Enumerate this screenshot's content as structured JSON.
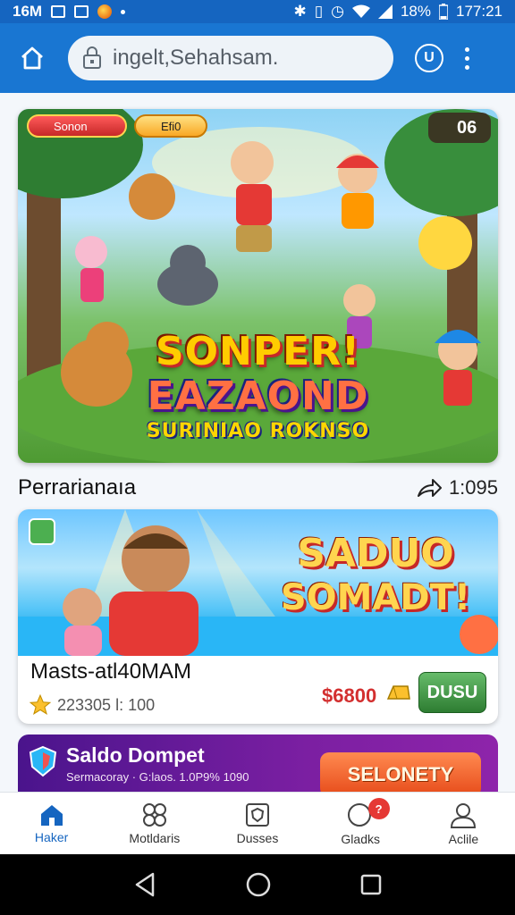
{
  "status_bar": {
    "left_text": "16M",
    "battery": "18%",
    "time": "177:21"
  },
  "browser": {
    "url": "ingelt,Sehahsam.",
    "tab_count": "U"
  },
  "hero": {
    "badge_left": "Sonon",
    "badge_mid": "Efi0",
    "badge_count": "06",
    "title_line1": "SONPER!",
    "title_line2": "EAZAOND",
    "title_line3": "SURINIAO ROKNSO"
  },
  "section": {
    "title": "Perrarianaıa",
    "share_count": "1:095"
  },
  "promo": {
    "title_line1": "SADUO",
    "title_line2": "SOMADT!",
    "name": "Masts-atl40MAM",
    "meta": "223305 l: 100",
    "price": "$6800",
    "buy_label": "DUSU"
  },
  "wallet": {
    "title": "Saldo Dompet",
    "subtitle": "Sermacoray · G:laos. 1.0P9% 1090",
    "button_label": "SELONETY"
  },
  "bottom_nav": [
    {
      "label": "Haker",
      "icon": "home-icon"
    },
    {
      "label": "Motldaris",
      "icon": "grid-icon"
    },
    {
      "label": "Dusses",
      "icon": "shield-icon"
    },
    {
      "label": "Gladks",
      "icon": "chat-icon",
      "badge": "?"
    },
    {
      "label": "Aclile",
      "icon": "profile-icon"
    }
  ],
  "colors": {
    "primary": "#1976d2",
    "status_bar": "#1565c0",
    "buy_button": "#43a047",
    "price": "#d32f2f",
    "wallet_bg": "#7b1fa2"
  }
}
